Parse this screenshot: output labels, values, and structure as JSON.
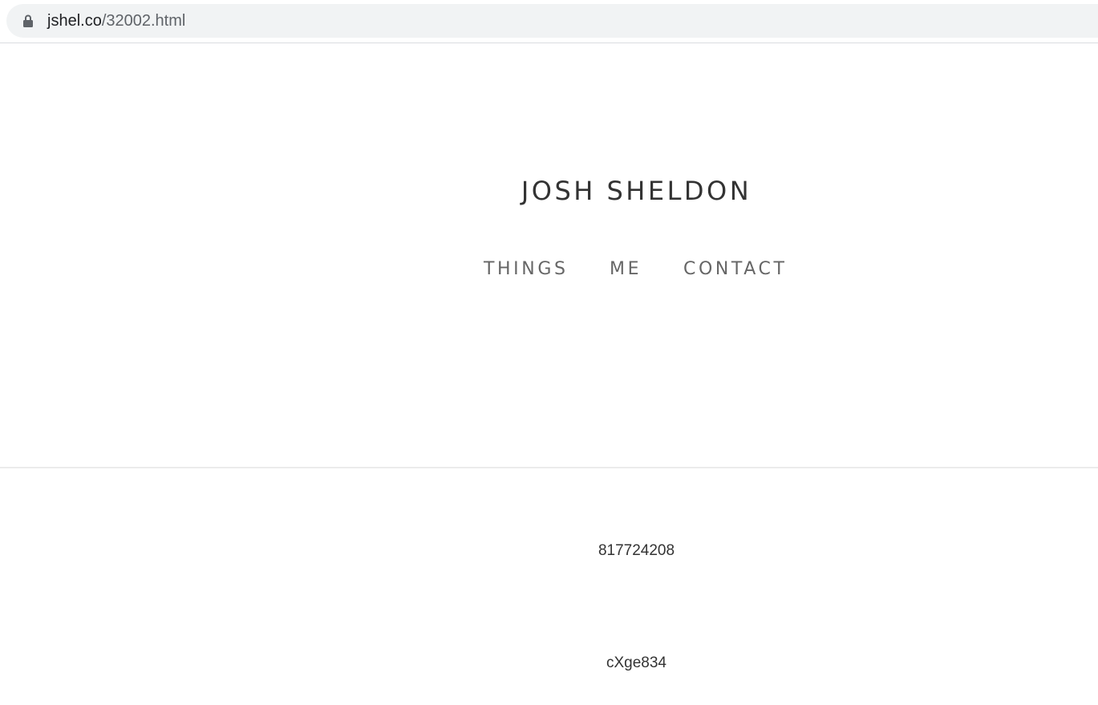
{
  "browser": {
    "url_host": "jshel.co",
    "url_path": "/32002.html",
    "lock_icon": "lock-icon"
  },
  "site": {
    "title": "JOSH SHELDON",
    "nav": [
      {
        "label": "THINGS"
      },
      {
        "label": "ME"
      },
      {
        "label": "CONTACT"
      }
    ]
  },
  "content": {
    "line_1": "817724208",
    "line_2": "cXge834"
  },
  "colors": {
    "title": "#333333",
    "nav": "#666666",
    "divider": "#ebebeb",
    "omnibox_bg": "#f1f3f4"
  }
}
